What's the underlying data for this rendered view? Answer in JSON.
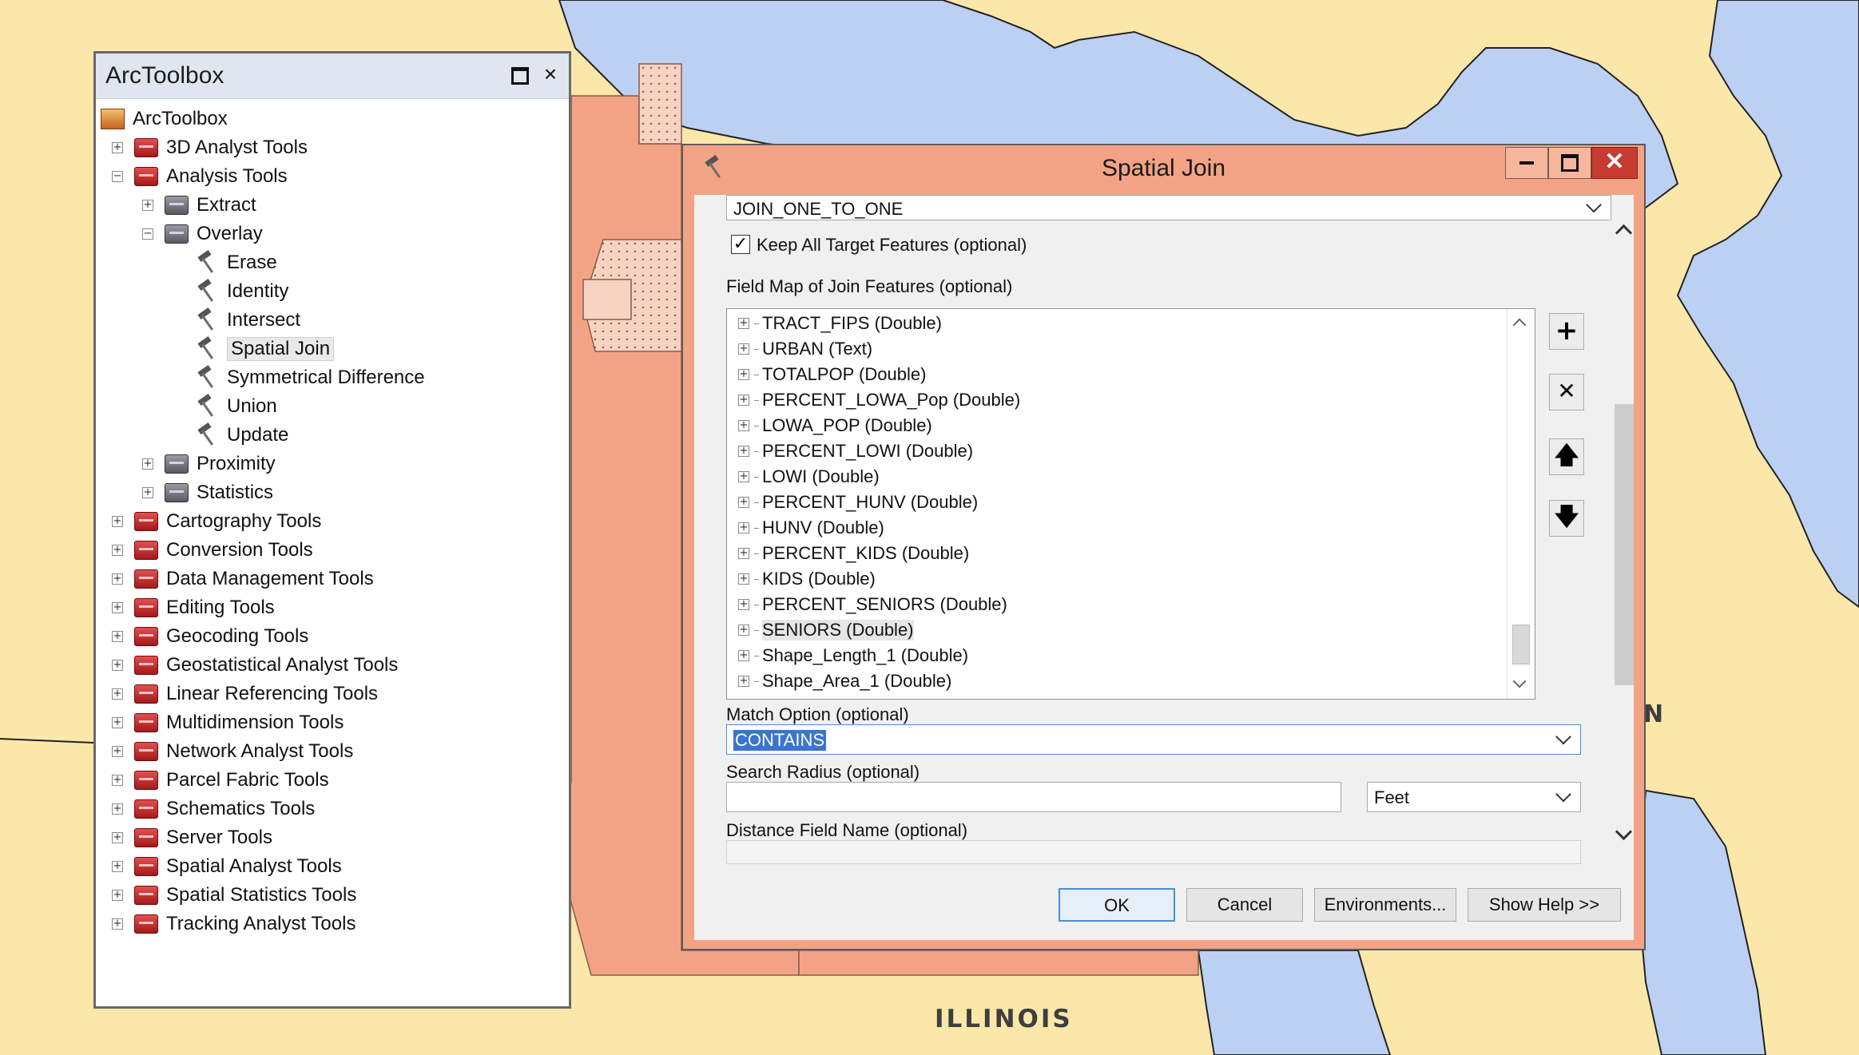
{
  "map": {
    "state_labels": [
      "ILLINOIS",
      "N"
    ],
    "colors": {
      "water": "#bcd0f4",
      "land": "#fbe7a9",
      "counties": "#f3a385"
    }
  },
  "toolbox": {
    "title": "ArcToolbox",
    "controls": {
      "close": "×"
    },
    "tree": [
      {
        "label": "ArcToolbox",
        "icon": "arctoolbox-root-icon",
        "level": 0,
        "expander": ""
      },
      {
        "label": "3D Analyst Tools",
        "icon": "toolbox-icon",
        "level": 1,
        "expander": "+"
      },
      {
        "label": "Analysis Tools",
        "icon": "toolbox-icon",
        "level": 1,
        "expander": "−"
      },
      {
        "label": "Extract",
        "icon": "toolset-icon",
        "level": 2,
        "expander": "+"
      },
      {
        "label": "Overlay",
        "icon": "toolset-icon",
        "level": 2,
        "expander": "−"
      },
      {
        "label": "Erase",
        "icon": "hammer-tool-icon",
        "level": 3,
        "expander": ""
      },
      {
        "label": "Identity",
        "icon": "hammer-tool-icon",
        "level": 3,
        "expander": ""
      },
      {
        "label": "Intersect",
        "icon": "hammer-tool-icon",
        "level": 3,
        "expander": ""
      },
      {
        "label": "Spatial Join",
        "icon": "hammer-tool-icon",
        "level": 3,
        "expander": "",
        "selected": true
      },
      {
        "label": "Symmetrical Difference",
        "icon": "hammer-tool-icon",
        "level": 3,
        "expander": ""
      },
      {
        "label": "Union",
        "icon": "hammer-tool-icon",
        "level": 3,
        "expander": ""
      },
      {
        "label": "Update",
        "icon": "hammer-tool-icon",
        "level": 3,
        "expander": ""
      },
      {
        "label": "Proximity",
        "icon": "toolset-icon",
        "level": 2,
        "expander": "+"
      },
      {
        "label": "Statistics",
        "icon": "toolset-icon",
        "level": 2,
        "expander": "+"
      },
      {
        "label": "Cartography Tools",
        "icon": "toolbox-icon",
        "level": 1,
        "expander": "+"
      },
      {
        "label": "Conversion Tools",
        "icon": "toolbox-icon",
        "level": 1,
        "expander": "+"
      },
      {
        "label": "Data Management Tools",
        "icon": "toolbox-icon",
        "level": 1,
        "expander": "+"
      },
      {
        "label": "Editing Tools",
        "icon": "toolbox-icon",
        "level": 1,
        "expander": "+"
      },
      {
        "label": "Geocoding Tools",
        "icon": "toolbox-icon",
        "level": 1,
        "expander": "+"
      },
      {
        "label": "Geostatistical Analyst Tools",
        "icon": "toolbox-icon",
        "level": 1,
        "expander": "+"
      },
      {
        "label": "Linear Referencing Tools",
        "icon": "toolbox-icon",
        "level": 1,
        "expander": "+"
      },
      {
        "label": "Multidimension Tools",
        "icon": "toolbox-icon",
        "level": 1,
        "expander": "+"
      },
      {
        "label": "Network Analyst Tools",
        "icon": "toolbox-icon",
        "level": 1,
        "expander": "+"
      },
      {
        "label": "Parcel Fabric Tools",
        "icon": "toolbox-icon",
        "level": 1,
        "expander": "+"
      },
      {
        "label": "Schematics Tools",
        "icon": "toolbox-icon",
        "level": 1,
        "expander": "+"
      },
      {
        "label": "Server Tools",
        "icon": "toolbox-icon",
        "level": 1,
        "expander": "+"
      },
      {
        "label": "Spatial Analyst Tools",
        "icon": "toolbox-icon",
        "level": 1,
        "expander": "+"
      },
      {
        "label": "Spatial Statistics Tools",
        "icon": "toolbox-icon",
        "level": 1,
        "expander": "+"
      },
      {
        "label": "Tracking Analyst Tools",
        "icon": "toolbox-icon",
        "level": 1,
        "expander": "+"
      }
    ]
  },
  "dialog": {
    "title": "Spatial Join",
    "window_controls": {
      "close": "✕"
    },
    "join_operation": {
      "value": "JOIN_ONE_TO_ONE"
    },
    "keep_all": {
      "label": "Keep All Target Features (optional)",
      "checked": true,
      "check_glyph": "✓"
    },
    "field_map": {
      "label": "Field Map of Join Features (optional)",
      "items": [
        "TRACT_FIPS (Double)",
        "URBAN (Text)",
        "TOTALPOP (Double)",
        "PERCENT_LOWA_Pop (Double)",
        "LOWA_POP (Double)",
        "PERCENT_LOWI (Double)",
        "LOWI (Double)",
        "PERCENT_HUNV (Double)",
        "HUNV (Double)",
        "PERCENT_KIDS (Double)",
        "KIDS (Double)",
        "PERCENT_SENIORS (Double)",
        "SENIORS (Double)",
        "Shape_Length_1 (Double)",
        "Shape_Area_1 (Double)"
      ],
      "selected_item": "SENIORS (Double)",
      "side_buttons": {
        "add": "+",
        "delete": "✕",
        "up": "🡅",
        "down": "🡇"
      }
    },
    "match_option": {
      "label": "Match Option (optional)",
      "value": "CONTAINS"
    },
    "search_radius": {
      "label": "Search Radius (optional)",
      "value": "",
      "units": "Feet"
    },
    "distance_field": {
      "label": "Distance Field Name (optional)",
      "value": ""
    },
    "buttons": {
      "ok": "OK",
      "cancel": "Cancel",
      "environments": "Environments...",
      "show_help": "Show Help >>"
    }
  }
}
